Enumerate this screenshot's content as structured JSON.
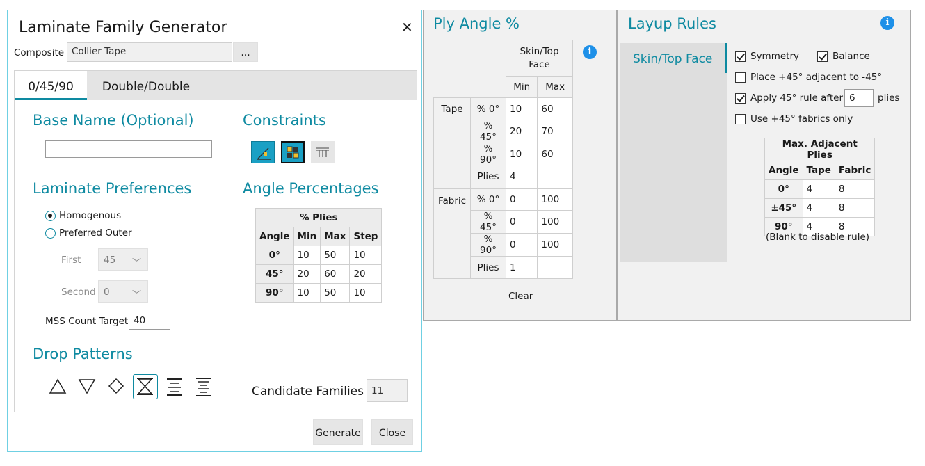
{
  "dialog": {
    "title": "Laminate Family Generator",
    "composite_label": "Composite",
    "composite_value": "Collier Tape",
    "browse_label": "...",
    "tabs": [
      "0/45/90",
      "Double/Double"
    ],
    "base_name_title": "Base Name (Optional)",
    "base_name_value": "",
    "constraints_title": "Constraints",
    "laminate_prefs_title": "Laminate Preferences",
    "radio_homogenous": "Homogenous",
    "radio_preferred_outer": "Preferred Outer",
    "first_label": "First",
    "first_value": "45",
    "second_label": "Second",
    "second_value": "0",
    "mss_label": "MSS Count Target",
    "mss_value": "40",
    "angle_pct_title": "Angle Percentages",
    "angle_table": {
      "title": "% Plies",
      "headers": [
        "Angle",
        "Min",
        "Max",
        "Step"
      ],
      "rows": [
        {
          "angle": "0°",
          "min": "10",
          "max": "50",
          "step": "10"
        },
        {
          "angle": "45°",
          "min": "20",
          "max": "60",
          "step": "20"
        },
        {
          "angle": "90°",
          "min": "10",
          "max": "50",
          "step": "10"
        }
      ]
    },
    "drop_patterns_title": "Drop Patterns",
    "candidate_label": "Candidate Families",
    "candidate_value": "11",
    "generate_label": "Generate",
    "close_label": "Close",
    "close_icon": "close-icon"
  },
  "ply_angle": {
    "title": "Ply Angle %",
    "col_header": "Skin/Top Face",
    "min_label": "Min",
    "max_label": "Max",
    "groups": [
      {
        "name": "Tape",
        "rows": [
          {
            "label": "% 0°",
            "min": "10",
            "max": "60"
          },
          {
            "label": "% 45°",
            "min": "20",
            "max": "70"
          },
          {
            "label": "% 90°",
            "min": "10",
            "max": "60"
          },
          {
            "label": "Plies",
            "min": "4",
            "max": ""
          }
        ]
      },
      {
        "name": "Fabric",
        "rows": [
          {
            "label": "% 0°",
            "min": "0",
            "max": "100"
          },
          {
            "label": "% 45°",
            "min": "0",
            "max": "100"
          },
          {
            "label": "% 90°",
            "min": "0",
            "max": "100"
          },
          {
            "label": "Plies",
            "min": "1",
            "max": ""
          }
        ]
      }
    ],
    "clear_label": "Clear"
  },
  "layup_rules": {
    "title": "Layup Rules",
    "side_item": "Skin/Top Face",
    "symmetry": "Symmetry",
    "balance": "Balance",
    "place_adjacent": "Place +45° adjacent to -45°",
    "apply_rule": "Apply 45° rule after",
    "apply_rule_value": "6",
    "plies_label": "plies",
    "fabrics_only": "Use +45° fabrics only",
    "adj_table": {
      "title": "Max. Adjacent Plies",
      "headers": [
        "Angle",
        "Tape",
        "Fabric"
      ],
      "rows": [
        {
          "angle": "0°",
          "tape": "4",
          "fabric": "8"
        },
        {
          "angle": "±45°",
          "tape": "4",
          "fabric": "8"
        },
        {
          "angle": "90°",
          "tape": "4",
          "fabric": "8"
        }
      ]
    },
    "blank_note": "(Blank to disable rule)"
  },
  "colors": {
    "accent": "#0e8aa1",
    "info": "#1e90e8"
  }
}
